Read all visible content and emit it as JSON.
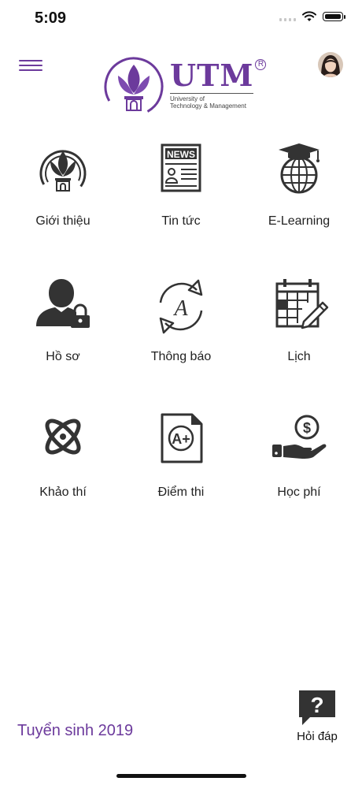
{
  "status_bar": {
    "time": "5:09"
  },
  "header": {
    "logo_title": "UTM",
    "logo_registered": "R",
    "logo_subtitle_line1": "University of",
    "logo_subtitle_line2": "Technology & Management"
  },
  "menu": [
    {
      "label": "Giới thiệu",
      "icon": "utm-lotus-icon"
    },
    {
      "label": "Tin tức",
      "icon": "newspaper-icon"
    },
    {
      "label": "E-Learning",
      "icon": "globe-graduation-cap-icon"
    },
    {
      "label": "Hồ sơ",
      "icon": "user-lock-icon"
    },
    {
      "label": "Thông báo",
      "icon": "refresh-a-icon"
    },
    {
      "label": "Lịch",
      "icon": "calendar-pencil-icon"
    },
    {
      "label": "Khảo thí",
      "icon": "atom-icon"
    },
    {
      "label": "Điểm thi",
      "icon": "grade-a-plus-icon"
    },
    {
      "label": "Học phí",
      "icon": "hand-dollar-icon"
    }
  ],
  "footer": {
    "admissions_label": "Tuyển sinh 2019",
    "faq_label": "Hỏi đáp",
    "faq_icon": "?"
  },
  "colors": {
    "brand": "#6c3a9c",
    "icon": "#333333"
  }
}
